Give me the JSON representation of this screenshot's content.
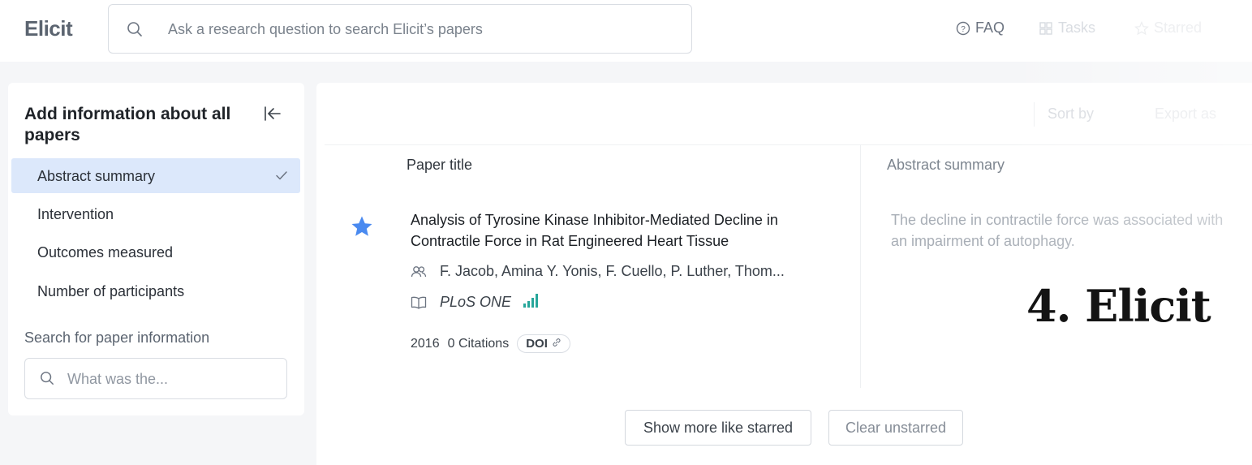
{
  "app": {
    "logo": "Elicit"
  },
  "search": {
    "placeholder": "Ask a research question to search Elicit’s papers"
  },
  "nav": {
    "faq": "FAQ",
    "tasks": "Tasks",
    "starred": "Starred"
  },
  "sidebar": {
    "title": "Add information about all papers",
    "items": [
      {
        "label": "Abstract summary",
        "selected": true
      },
      {
        "label": "Intervention"
      },
      {
        "label": "Outcomes measured"
      },
      {
        "label": "Number of participants"
      }
    ],
    "search_label": "Search for paper information",
    "search_placeholder": "What was the..."
  },
  "toolbar": {
    "sort_by": "Sort by",
    "export_as": "Export as"
  },
  "table": {
    "columns": [
      "Paper title",
      "Abstract summary"
    ],
    "rows": [
      {
        "title": "Analysis of Tyrosine Kinase Inhibitor-Mediated Decline in Contractile Force in Rat Engineered Heart Tissue",
        "authors": "F. Jacob, Amina Y. Yonis, F. Cuello, P. Luther, Thom...",
        "venue": "PLoS ONE",
        "year": "2016",
        "citations": "0 Citations",
        "doi": "DOI",
        "abstract_line1": "The decline in contractile force was associated with",
        "abstract_line2": "an impairment of autophagy.",
        "starred": true
      }
    ]
  },
  "buttons": {
    "show_more": "Show more like starred",
    "clear": "Clear unstarred"
  },
  "overlay": {
    "title": "4. Elicit"
  },
  "colors": {
    "accent": "#4a8af0",
    "selected_bg": "#dce8fb",
    "bars": "#26a69a"
  }
}
